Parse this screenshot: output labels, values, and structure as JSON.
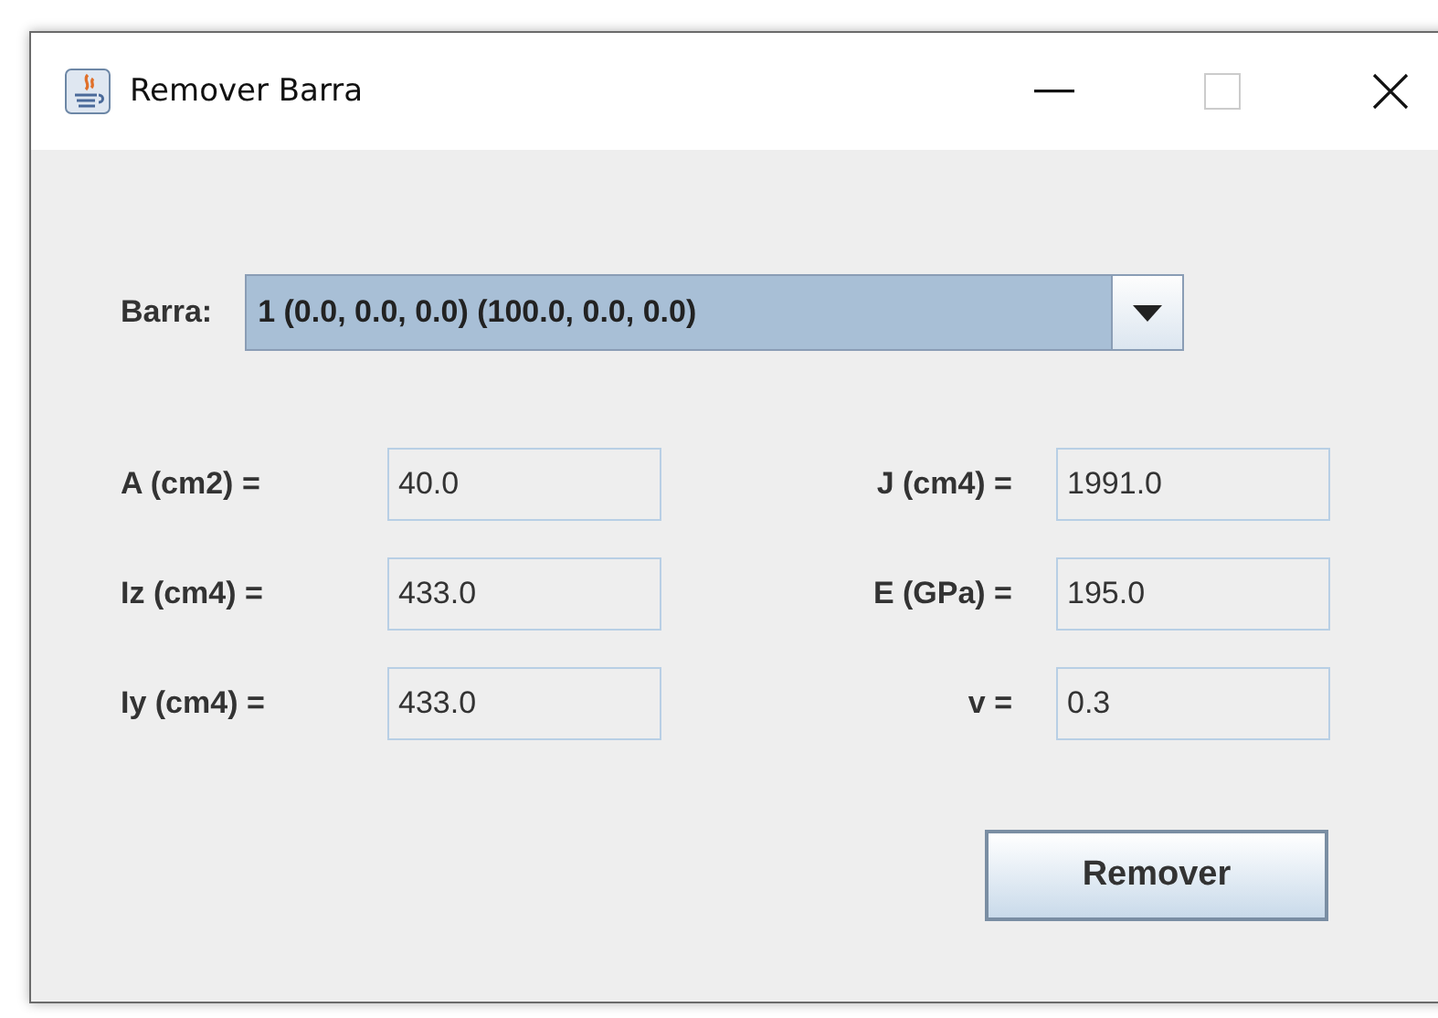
{
  "window": {
    "title": "Remover Barra"
  },
  "barra": {
    "label": "Barra:",
    "value": "1 (0.0, 0.0, 0.0) (100.0, 0.0, 0.0)"
  },
  "fields": [
    {
      "label": "A (cm2) =",
      "value": "40.0",
      "editable": false
    },
    {
      "label": "J (cm4) =",
      "value": "1991.0",
      "editable": false
    },
    {
      "label": "Iz (cm4) =",
      "value": "433.0",
      "editable": false
    },
    {
      "label": "E (GPa) =",
      "value": "195.0",
      "editable": false
    },
    {
      "label": "Iy (cm4) =",
      "value": "433.0",
      "editable": false
    },
    {
      "label": "v =",
      "value": "0.3",
      "editable": false
    }
  ],
  "buttons": [
    "Remover"
  ]
}
